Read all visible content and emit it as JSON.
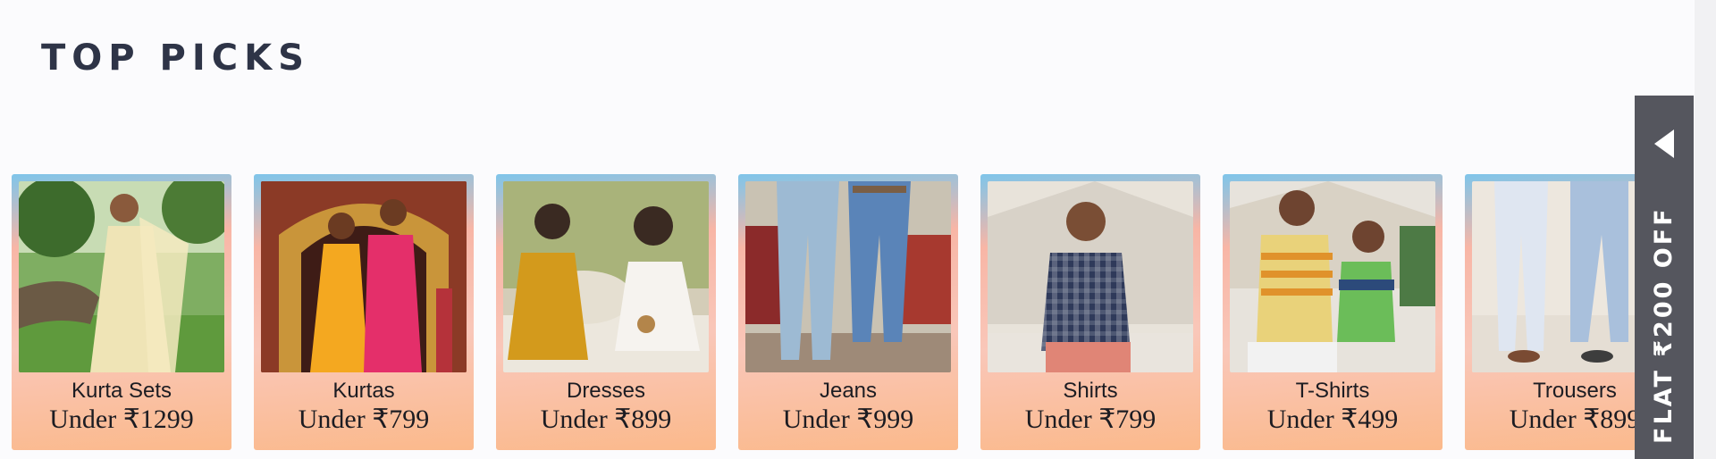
{
  "section": {
    "title": "TOP PICKS"
  },
  "cards": [
    {
      "category": "Kurta Sets",
      "price": "Under ₹1299"
    },
    {
      "category": "Kurtas",
      "price": "Under ₹799"
    },
    {
      "category": "Dresses",
      "price": "Under ₹899"
    },
    {
      "category": "Jeans",
      "price": "Under ₹999"
    },
    {
      "category": "Shirts",
      "price": "Under ₹799"
    },
    {
      "category": "T-Shirts",
      "price": "Under ₹499"
    },
    {
      "category": "Trousers",
      "price": "Under ₹899"
    }
  ],
  "offer_tab": {
    "label": "FLAT ₹200 OFF",
    "icon": "chevron-left-icon"
  },
  "colors": {
    "title": "#2e3447",
    "offer_tab_bg": "#55565e",
    "card_gradient_top": "#7fc5ea",
    "card_gradient_bottom": "#fbb98b"
  }
}
